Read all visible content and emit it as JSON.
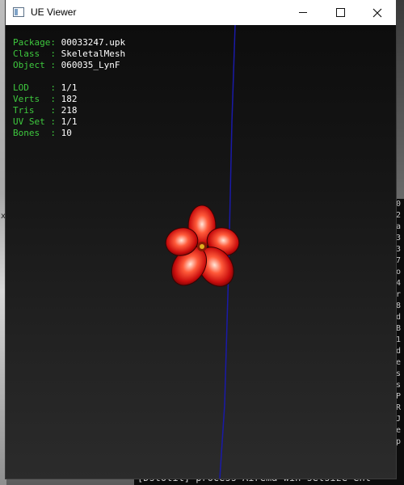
{
  "window": {
    "title": "UE Viewer",
    "controls": {
      "minimize": "minimize-icon",
      "maximize": "maximize-icon",
      "close": "close-icon"
    }
  },
  "info": {
    "object_lines": [
      {
        "key": "Package: ",
        "value": "00033247.upk"
      },
      {
        "key": "Class  : ",
        "value": "SkeletalMesh"
      },
      {
        "key": "Object : ",
        "value": "060035_LynF"
      }
    ],
    "stats_lines": [
      {
        "key": "LOD    : ",
        "value": "1/1"
      },
      {
        "key": "Verts  : ",
        "value": "182"
      },
      {
        "key": "Tris   : ",
        "value": "218"
      },
      {
        "key": "UV Set : ",
        "value": "1/1"
      },
      {
        "key": "Bones  : ",
        "value": "10"
      }
    ]
  },
  "colors": {
    "info_key": "#3ec93e",
    "info_value": "#ffffff",
    "axis_line": "#1a1aa8",
    "petal": "#d61010"
  },
  "background_console": {
    "right_chars": [
      "0",
      "2",
      "a",
      "3",
      "3",
      "7",
      "o",
      "4",
      "r",
      "8",
      "d",
      "B",
      "1",
      "d",
      "e",
      "s",
      "s",
      "P",
      "R",
      "J",
      "e",
      "p"
    ],
    "bottom_line": "[Dstotil] process  Airema win setsize  ent"
  }
}
